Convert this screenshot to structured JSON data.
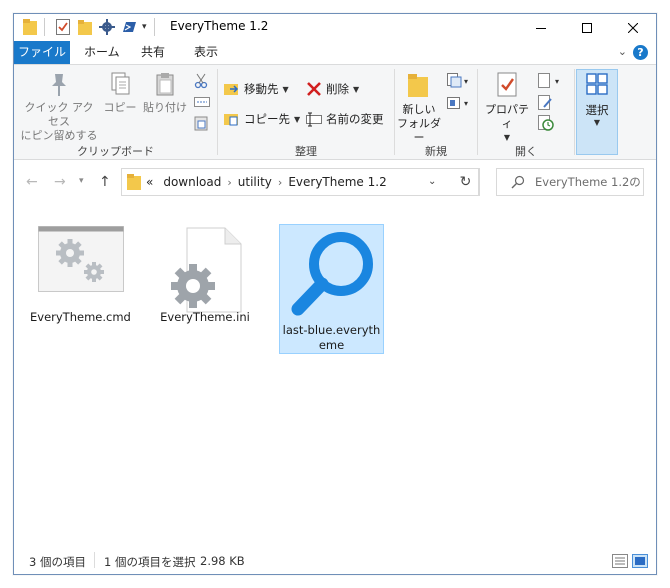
{
  "window": {
    "title": "EveryTheme 1.2"
  },
  "tabs": [
    {
      "label": "ファイル",
      "active": true
    },
    {
      "label": "ホーム",
      "active": false
    },
    {
      "label": "共有",
      "active": false
    },
    {
      "label": "表示",
      "active": false
    }
  ],
  "ribbon": {
    "clipboard": {
      "label": "クリップボード",
      "pin_line1": "クイック アクセス",
      "pin_line2": "にピン留めする",
      "copy": "コピー",
      "paste": "貼り付け"
    },
    "organize": {
      "label": "整理",
      "move_to": "移動先",
      "copy_to": "コピー先",
      "delete": "削除",
      "rename": "名前の変更"
    },
    "new": {
      "label": "新規",
      "new_folder_line1": "新しい",
      "new_folder_line2": "フォルダー"
    },
    "open": {
      "label": "開く",
      "properties": "プロパティ"
    },
    "select": {
      "label": "選択"
    }
  },
  "address": {
    "overflow": "«",
    "crumbs": [
      "download",
      "utility",
      "EveryTheme 1.2"
    ]
  },
  "search": {
    "placeholder": "EveryTheme 1.2の..."
  },
  "files": [
    {
      "name": "EveryTheme.cmd",
      "icon": "cmd-gears-icon"
    },
    {
      "name": "EveryTheme.ini",
      "icon": "ini-gear-icon"
    },
    {
      "name_line1": "last-blue.everyth",
      "name_line2": "eme",
      "icon": "magnifier-icon",
      "selected": true
    }
  ],
  "status": {
    "item_count": "3 個の項目",
    "selection": "1 個の項目を選択",
    "size": "2.98 KB"
  },
  "colors": {
    "accent": "#1979ca",
    "selection_bg": "#cce8ff",
    "selection_border": "#99d1ff"
  }
}
